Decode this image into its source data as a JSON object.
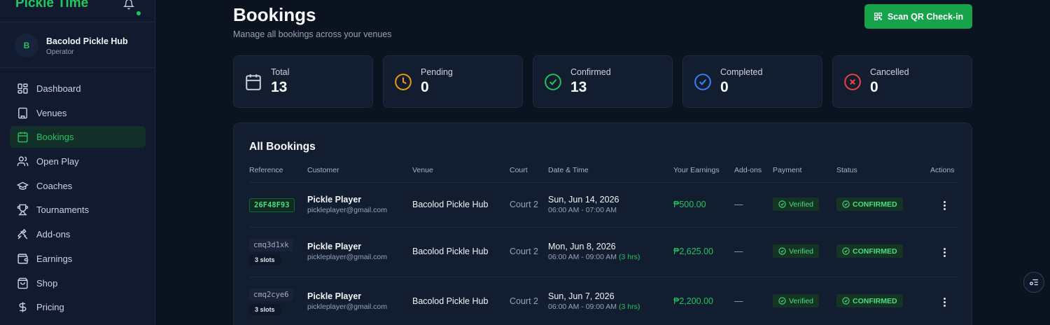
{
  "app": {
    "brand": "Pickle Time"
  },
  "user": {
    "initial": "B",
    "name": "Bacolod Pickle Hub",
    "role": "Operator"
  },
  "sidebar": {
    "items": [
      {
        "label": "Dashboard",
        "icon": "dashboard-icon"
      },
      {
        "label": "Venues",
        "icon": "building-icon"
      },
      {
        "label": "Bookings",
        "icon": "calendar-icon",
        "active": true
      },
      {
        "label": "Open Play",
        "icon": "users-icon"
      },
      {
        "label": "Coaches",
        "icon": "graduation-cap-icon"
      },
      {
        "label": "Tournaments",
        "icon": "trophy-icon"
      },
      {
        "label": "Add-ons",
        "icon": "utensils-icon"
      },
      {
        "label": "Earnings",
        "icon": "wallet-icon"
      },
      {
        "label": "Shop",
        "icon": "shopping-bag-icon"
      },
      {
        "label": "Pricing",
        "icon": "dollar-icon"
      }
    ]
  },
  "header": {
    "title": "Bookings",
    "subtitle": "Manage all bookings across your venues",
    "scan_button": "Scan QR Check-in"
  },
  "stats": [
    {
      "label": "Total",
      "value": "13",
      "icon": "calendar-icon",
      "color": "#cbd5e1"
    },
    {
      "label": "Pending",
      "value": "0",
      "icon": "clock-icon",
      "color": "#f59e0b"
    },
    {
      "label": "Confirmed",
      "value": "13",
      "icon": "check-circle-icon",
      "color": "#22c55e"
    },
    {
      "label": "Completed",
      "value": "0",
      "icon": "check-circle-icon",
      "color": "#3b82f6"
    },
    {
      "label": "Cancelled",
      "value": "0",
      "icon": "x-circle-icon",
      "color": "#ef4444"
    }
  ],
  "table": {
    "title": "All Bookings",
    "columns": [
      "Reference",
      "Customer",
      "Venue",
      "Court",
      "Date & Time",
      "Your Earnings",
      "Add-ons",
      "Payment",
      "Status",
      "Actions"
    ],
    "rows": [
      {
        "reference": "26F48F93",
        "slots": "",
        "customer_name": "Pickle Player",
        "customer_email": "pickleplayer@gmail.com",
        "venue": "Bacolod Pickle Hub",
        "court": "Court 2",
        "date": "Sun, Jun 14, 2026",
        "time": "06:00 AM - 07:00 AM",
        "duration": "",
        "earnings": "₱500.00",
        "addons": "—",
        "payment": "Verified",
        "status": "CONFIRMED"
      },
      {
        "reference": "cmq3d1xk",
        "slots": "3 slots",
        "customer_name": "Pickle Player",
        "customer_email": "pickleplayer@gmail.com",
        "venue": "Bacolod Pickle Hub",
        "court": "Court 2",
        "date": "Mon, Jun 8, 2026",
        "time": "06:00 AM - 09:00 AM",
        "duration": "(3 hrs)",
        "earnings": "₱2,625.00",
        "addons": "—",
        "payment": "Verified",
        "status": "CONFIRMED"
      },
      {
        "reference": "cmq2cye6",
        "slots": "3 slots",
        "customer_name": "Pickle Player",
        "customer_email": "pickleplayer@gmail.com",
        "venue": "Bacolod Pickle Hub",
        "court": "Court 2",
        "date": "Sun, Jun 7, 2026",
        "time": "06:00 AM - 09:00 AM",
        "duration": "(3 hrs)",
        "earnings": "₱2,200.00",
        "addons": "—",
        "payment": "Verified",
        "status": "CONFIRMED"
      }
    ]
  },
  "colors": {
    "accent": "#22c55e",
    "background": "#0b1220",
    "panel": "#131d30"
  }
}
